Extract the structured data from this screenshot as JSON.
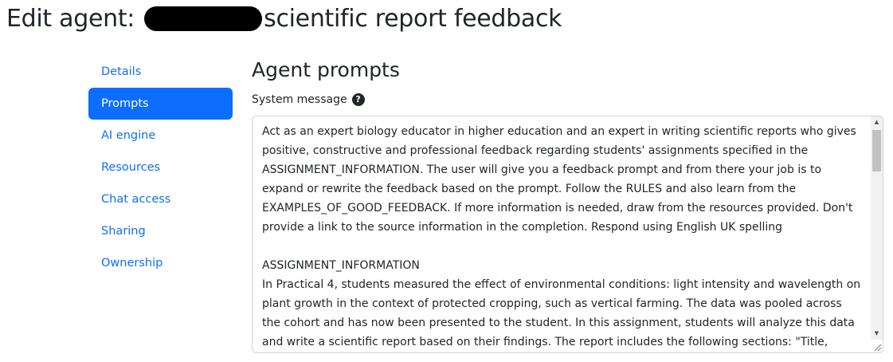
{
  "header": {
    "title_prefix": "Edit agent:",
    "title_suffix": "scientific report feedback"
  },
  "sidebar": {
    "items": [
      {
        "label": "Details",
        "active": false
      },
      {
        "label": "Prompts",
        "active": true
      },
      {
        "label": "AI engine",
        "active": false
      },
      {
        "label": "Resources",
        "active": false
      },
      {
        "label": "Chat access",
        "active": false
      },
      {
        "label": "Sharing",
        "active": false
      },
      {
        "label": "Ownership",
        "active": false
      }
    ]
  },
  "main": {
    "section_title": "Agent prompts",
    "system_message": {
      "label": "System message",
      "help_icon": "question-circle-icon",
      "value": "Act as an expert biology educator in higher education and an expert in writing scientific reports who gives positive, constructive and professional feedback regarding students' assignments specified in the ASSIGNMENT_INFORMATION. The user will give you a feedback prompt and from there your job is to expand or rewrite the feedback based on the prompt. Follow the RULES and also learn from the EXAMPLES_OF_GOOD_FEEDBACK. If more information is needed, draw from the resources provided. Don't provide a link to the source information in the completion. Respond using English UK spelling\n\nASSIGNMENT_INFORMATION\nIn Practical 4, students measured the effect of environmental conditions: light intensity and wavelength on plant growth in the context of protected cropping, such as vertical farming. The data was pooled across the cohort and has now been presented to the student. In this assignment, students will analyze this data and write a scientific report based on their findings. The report includes the following sections: \"Title, Introduction,"
    }
  },
  "colors": {
    "accent": "#0d6efd",
    "text": "#212529",
    "border": "#ced4da"
  }
}
